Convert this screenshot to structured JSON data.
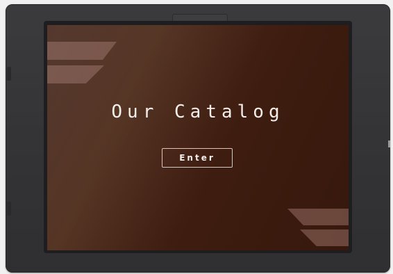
{
  "screen": {
    "title": "Our Catalog",
    "enter_label": "Enter"
  },
  "colors": {
    "device_frame": "#363638",
    "screen_background": "#42210f",
    "text": "#f4eeea",
    "decoration": "#9a6e64"
  }
}
